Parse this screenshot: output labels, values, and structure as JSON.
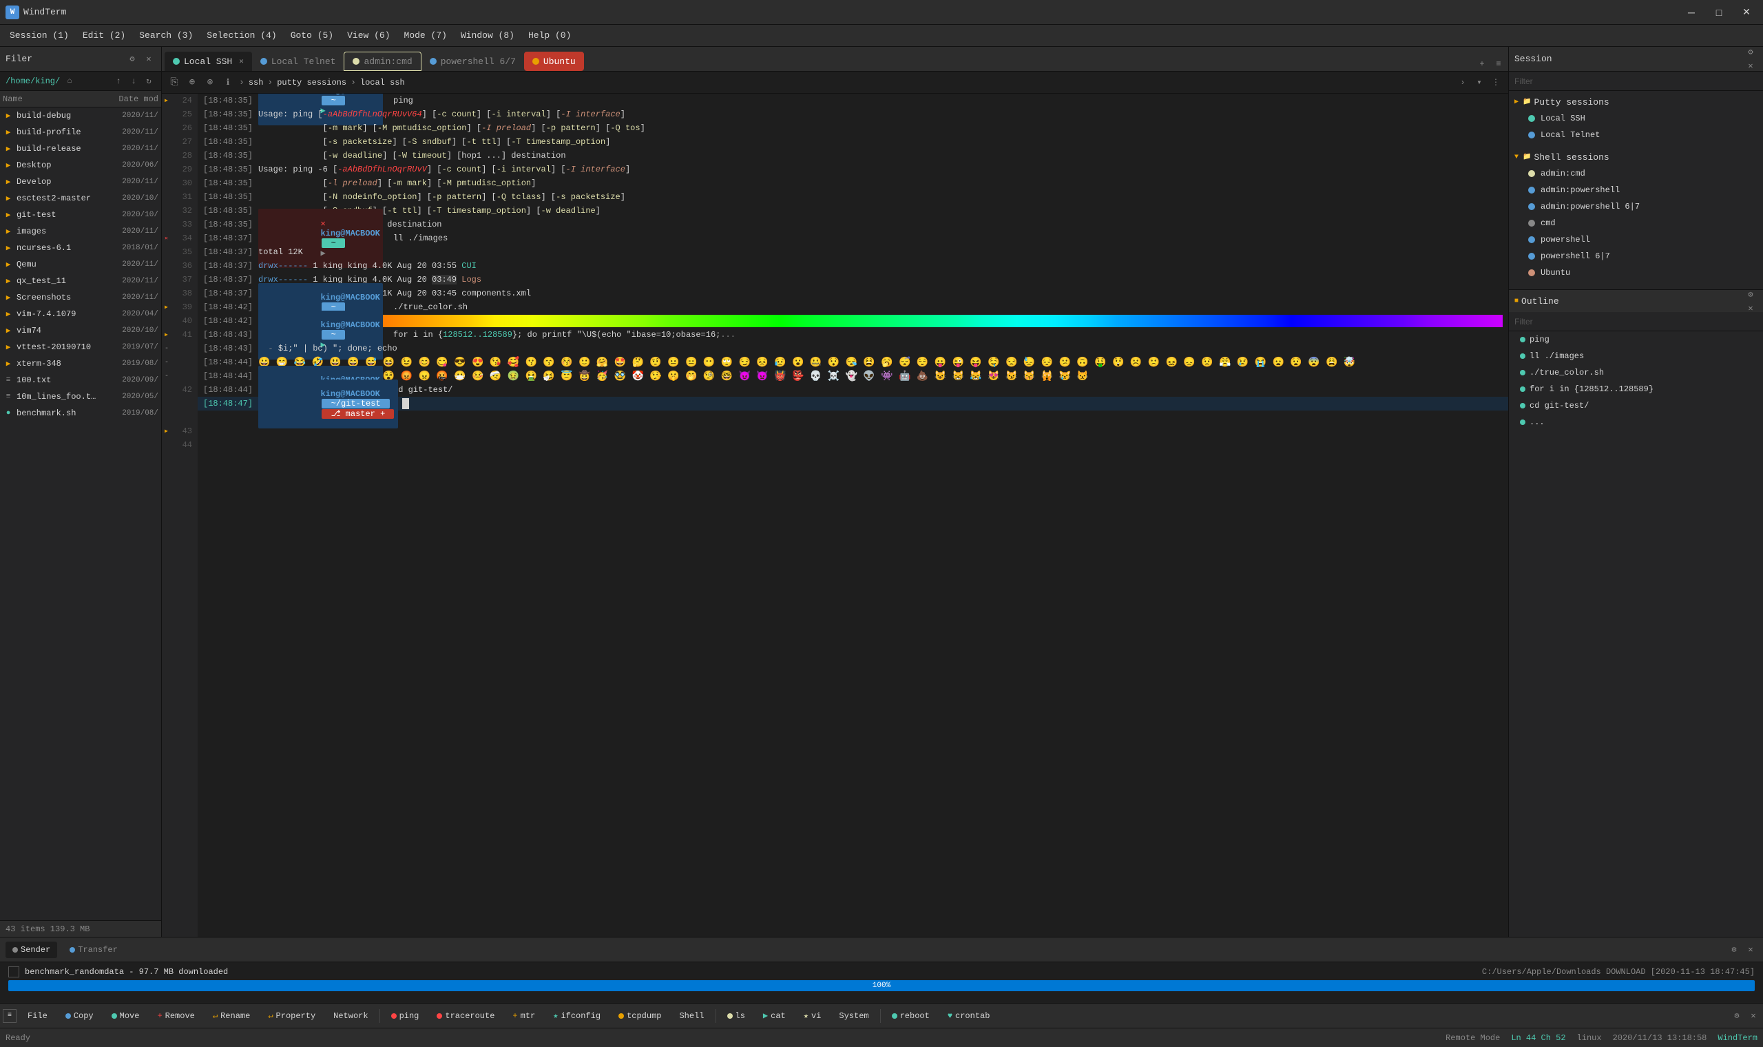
{
  "app": {
    "title": "WindTerm",
    "icon": "W"
  },
  "titlebar": {
    "title": "WindTerm",
    "minimize": "─",
    "maximize": "□",
    "close": "✕"
  },
  "menubar": {
    "items": [
      {
        "label": "Session (1)"
      },
      {
        "label": "Edit (2)"
      },
      {
        "label": "Search (3)"
      },
      {
        "label": "Selection (4)"
      },
      {
        "label": "Goto (5)"
      },
      {
        "label": "View (6)"
      },
      {
        "label": "Mode (7)"
      },
      {
        "label": "Window (8)"
      },
      {
        "label": "Help (0)"
      }
    ]
  },
  "filer": {
    "title": "Filer",
    "path": "/home/king/",
    "columns": {
      "name": "Name",
      "date": "Date mod"
    },
    "items": [
      {
        "name": "build-debug",
        "date": "2020/11/",
        "type": "folder"
      },
      {
        "name": "build-profile",
        "date": "2020/11/",
        "type": "folder"
      },
      {
        "name": "build-release",
        "date": "2020/11/",
        "type": "folder"
      },
      {
        "name": "Desktop",
        "date": "2020/06/",
        "type": "folder"
      },
      {
        "name": "Develop",
        "date": "2020/11/",
        "type": "folder"
      },
      {
        "name": "esctest2-master",
        "date": "2020/10/",
        "type": "folder"
      },
      {
        "name": "git-test",
        "date": "2020/10/",
        "type": "folder"
      },
      {
        "name": "images",
        "date": "2020/11/",
        "type": "folder"
      },
      {
        "name": "ncurses-6.1",
        "date": "2018/01/",
        "type": "folder"
      },
      {
        "name": "Qemu",
        "date": "2020/11/",
        "type": "folder"
      },
      {
        "name": "qx_test_11",
        "date": "2020/11/",
        "type": "folder"
      },
      {
        "name": "Screenshots",
        "date": "2020/11/",
        "type": "folder"
      },
      {
        "name": "vim-7.4.1079",
        "date": "2020/04/",
        "type": "folder"
      },
      {
        "name": "vim74",
        "date": "2020/10/",
        "type": "folder"
      },
      {
        "name": "vttest-20190710",
        "date": "2019/07/",
        "type": "folder"
      },
      {
        "name": "xterm-348",
        "date": "2019/08/",
        "type": "folder"
      },
      {
        "name": "100.txt",
        "date": "2020/09/",
        "type": "file"
      },
      {
        "name": "10m_lines_foo.t...",
        "date": "2020/05/",
        "type": "file"
      },
      {
        "name": "benchmark.sh",
        "date": "2019/08/",
        "type": "script"
      }
    ],
    "footer": "43 items 139.3 MB"
  },
  "tabs": [
    {
      "label": "Local SSH",
      "color": "#4ec9b0",
      "active": true,
      "dot_color": "#4ec9b0"
    },
    {
      "label": "Local Telnet",
      "color": "#569cd6",
      "active": false,
      "dot_color": "#569cd6"
    },
    {
      "label": "admin:cmd",
      "color": "#dcdcaa",
      "active": false,
      "dot_color": "#dcdcaa"
    },
    {
      "label": "powershell 6/7",
      "color": "#569cd6",
      "active": false,
      "dot_color": "#569cd6"
    },
    {
      "label": "Ubuntu",
      "color": "#e8a000",
      "active": false,
      "dot_color": "#e8a000"
    }
  ],
  "address_bar": {
    "items": [
      "ssh",
      "putty sessions",
      "local ssh"
    ]
  },
  "terminal": {
    "lines": [
      {
        "num": 24,
        "ts": "[18:48:35]",
        "content": "king@MACBOOK  ~  ping",
        "type": "prompt"
      },
      {
        "num": 25,
        "ts": "[18:48:35]",
        "content": "Usage: ping [-aAbBdDfhLnOqrRUvV64] [-c count] [-i interval] [-I interface]",
        "type": "output"
      },
      {
        "num": 26,
        "ts": "[18:48:35]",
        "content": "             [-m mark] [-M pmtudisc_option] [-I preload] [-p pattern] [-Q tos]",
        "type": "output"
      },
      {
        "num": 27,
        "ts": "[18:48:35]",
        "content": "             [-s packetsize] [-S sndbuf] [-t ttl] [-T timestamp_option]",
        "type": "output"
      },
      {
        "num": 28,
        "ts": "[18:48:35]",
        "content": "             [-w deadline] [-W timeout] [hop1 ...] destination",
        "type": "output"
      },
      {
        "num": 29,
        "ts": "[18:48:35]",
        "content": "Usage: ping -6 [-aAbBdDfhLnOqrRUvV] [-c count] [-i interval] [-I interface]",
        "type": "output"
      },
      {
        "num": 30,
        "ts": "[18:48:35]",
        "content": "             [-l preload] [-m mark] [-M pmtudisc_option]",
        "type": "output"
      },
      {
        "num": 31,
        "ts": "[18:48:35]",
        "content": "             [-N nodeinfo_option] [-p pattern] [-Q tclass] [-s packetsize]",
        "type": "output"
      },
      {
        "num": 32,
        "ts": "[18:48:35]",
        "content": "             [-S sndbuf] [-t ttl] [-T timestamp_option] [-w deadline]",
        "type": "output"
      },
      {
        "num": 33,
        "ts": "[18:48:35]",
        "content": "             [-W timeout] destination",
        "type": "output"
      },
      {
        "num": 34,
        "ts": "[18:48:37]",
        "content": "king@MACBOOK  ~   ll ./images",
        "type": "prompt_x"
      },
      {
        "num": 35,
        "ts": "[18:48:37]",
        "content": "total 12K",
        "type": "output"
      },
      {
        "num": 36,
        "ts": "[18:48:37]",
        "content": "drwx------ 1 king king 4.0K Aug 20 03:55 CUI",
        "type": "output_dir_1"
      },
      {
        "num": 37,
        "ts": "[18:48:37]",
        "content": "drwx------ 1 king king 4.0K Aug 20 03:49 Logs",
        "type": "output_dir_2"
      },
      {
        "num": 38,
        "ts": "[18:48:37]",
        "content": "-rwx------ 1 king king  11K Aug 20 03:45 components.xml",
        "type": "output_file"
      },
      {
        "num": 39,
        "ts": "[18:48:42]",
        "content": "king@MACBOOK  ~   ./true_color.sh",
        "type": "prompt"
      },
      {
        "num": 40,
        "ts": "[18:48:42]",
        "content": "RAINBOW_BAR",
        "type": "rainbow"
      },
      {
        "num": 41,
        "ts": "[18:48:43]",
        "content": "king@MACBOOK  ~   for i in {128512..128589}; do printf \"\\U$(echo \"ibase=10;obase=16;...",
        "type": "prompt"
      },
      {
        "num": 42,
        "ts": "[18:48:44]",
        "content": "😀 😁 😂 🤣 😃 😄 😅 😆 😉 😊 😋 😎 😍 😘 🥰 😗 😙 😚 🙂 🤗 🤩 🤔 🤨 😐 😑 😶 🙄 😏 😣 😥 😮 🤐 😯 😪 😫 🥱 😴 😌 😛 😜 😝 🤤 😒 😓 😔 😕 🙃 🤑 😲 ☹️ 🙁 😖 😞 😟 😤 😢 😭 😦 😧 😨 😩 🤯 😬",
        "type": "emoji"
      },
      {
        "num": 43,
        "ts": "[18:48:44]",
        "content": "king@MACBOOK  ~   cd git-test/",
        "type": "prompt"
      },
      {
        "num": 44,
        "ts": "[18:48:47]",
        "content": "king@MACBOOK  ~/git-test  master  ",
        "type": "prompt_current"
      }
    ]
  },
  "session_panel": {
    "title": "Session",
    "filter_placeholder": "Filter",
    "putty_sessions": {
      "label": "Putty sessions",
      "items": [
        {
          "label": "Local SSH",
          "dot_color": "#4ec9b0"
        },
        {
          "label": "Local Telnet",
          "dot_color": "#569cd6"
        }
      ]
    },
    "shell_sessions": {
      "label": "Shell sessions",
      "items": [
        {
          "label": "admin:cmd",
          "dot_color": "#dcdcaa"
        },
        {
          "label": "admin:powershell",
          "dot_color": "#569cd6"
        },
        {
          "label": "admin:powershell 6|7",
          "dot_color": "#569cd6"
        },
        {
          "label": "cmd",
          "dot_color": "#888"
        },
        {
          "label": "powershell",
          "dot_color": "#569cd6"
        },
        {
          "label": "powershell 6|7",
          "dot_color": "#569cd6"
        },
        {
          "label": "Ubuntu",
          "dot_color": "#e8a000"
        }
      ]
    }
  },
  "outline_panel": {
    "title": "Outline",
    "filter_placeholder": "Filter",
    "items": [
      {
        "text": "ping"
      },
      {
        "text": "ll ./images"
      },
      {
        "text": "./true_color.sh"
      },
      {
        "text": "for i in {128512..128589}"
      },
      {
        "text": "cd git-test/"
      },
      {
        "text": "..."
      }
    ]
  },
  "transfer": {
    "tabs": [
      {
        "label": "Sender",
        "active": true,
        "dot_color": "#888"
      },
      {
        "label": "Transfer",
        "active": false,
        "dot_color": "#569cd6"
      }
    ],
    "download": {
      "name": "benchmark_randomdata - 97.7 MB downloaded",
      "path": "C:/Users/Apple/Downloads DOWNLOAD [2020-11-13 18:47:45]",
      "progress": 100,
      "progress_label": "100%"
    }
  },
  "statusbar": {
    "buttons": [
      {
        "label": "File",
        "dot_color": null
      },
      {
        "label": "Copy",
        "dot_color": "#569cd6"
      },
      {
        "label": "Move",
        "dot_color": "#4ec9b0"
      },
      {
        "label": "Remove",
        "dot_color": "#f44"
      },
      {
        "label": "Rename",
        "dot_color": "#e8a000"
      },
      {
        "label": "Property",
        "dot_color": "#e8a000"
      },
      {
        "label": "Network"
      },
      {
        "label": "ping",
        "dot_color": "#f44"
      },
      {
        "label": "traceroute",
        "dot_color": "#f44"
      },
      {
        "label": "mtr",
        "dot_color": "#e8a000"
      },
      {
        "label": "ifconfig",
        "dot_color": "#4ec9b0"
      },
      {
        "label": "tcpdump",
        "dot_color": "#e8a000"
      },
      {
        "label": "Shell"
      },
      {
        "label": "ls",
        "dot_color": "#dcdcaa"
      },
      {
        "label": "cat",
        "dot_color": "#4ec9b0"
      },
      {
        "label": "vi",
        "dot_color": "#dcdcaa"
      },
      {
        "label": "System"
      },
      {
        "label": "reboot",
        "dot_color": "#4ec9b0"
      },
      {
        "label": "crontab",
        "dot_color": "#4ec9b0"
      }
    ]
  },
  "bottom_status": {
    "ready": "Ready",
    "remote_mode": "Remote Mode",
    "position": "Ln 44 Ch 52",
    "os": "linux",
    "date": "2020/11/13 13:18:58",
    "app": "WindTerm"
  }
}
